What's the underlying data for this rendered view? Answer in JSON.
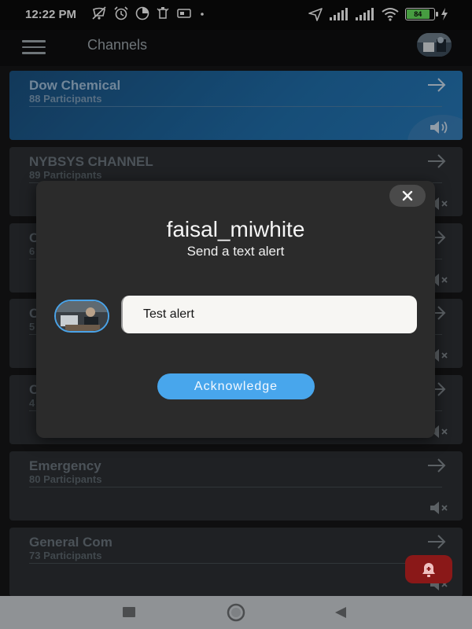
{
  "status_bar": {
    "time": "12:22 PM",
    "battery_level": "84",
    "left_icons": [
      "mute-icon",
      "alarm-icon",
      "data-saver-icon",
      "notification-icon",
      "screen-icon",
      "dot-icon"
    ],
    "right_icons": [
      "location-icon",
      "signal-icon",
      "signal-icon",
      "wifi-icon",
      "battery-icon",
      "charging-icon"
    ]
  },
  "app_bar": {
    "title": "Channels",
    "menu_icon": "hamburger-menu-icon",
    "avatar": "profile-avatar"
  },
  "channels": [
    {
      "name": "Dow Chemical",
      "participants": "88 Participants",
      "active": true,
      "sound": "speaker-on-icon"
    },
    {
      "name": "NYBSYS CHANNEL",
      "participants": "89 Participants",
      "active": false,
      "sound": "speaker-muted-icon"
    },
    {
      "name": "C",
      "participants": "6",
      "active": false,
      "sound": "speaker-muted-icon"
    },
    {
      "name": "C",
      "participants": "5",
      "active": false,
      "sound": "speaker-muted-icon"
    },
    {
      "name": "C",
      "participants": "4",
      "active": false,
      "sound": "speaker-muted-icon"
    },
    {
      "name": "Emergency",
      "participants": "80 Participants",
      "active": false,
      "sound": "speaker-muted-icon"
    },
    {
      "name": "General Com",
      "participants": "73 Participants",
      "active": false,
      "sound": "speaker-muted-icon"
    }
  ],
  "modal": {
    "sender": "faisal_miwhite",
    "subtitle": "Send a text alert",
    "message": "Test alert",
    "acknowledge_label": "Acknowledge",
    "close_icon": "close-icon"
  },
  "colors": {
    "accent": "#48a6ec",
    "active_card": "#1f6ba6",
    "alert_fab": "#8a1818",
    "battery": "#63d85a"
  },
  "nav_bar": {
    "recent": "recent-apps-icon",
    "home": "home-icon",
    "back": "back-icon"
  }
}
